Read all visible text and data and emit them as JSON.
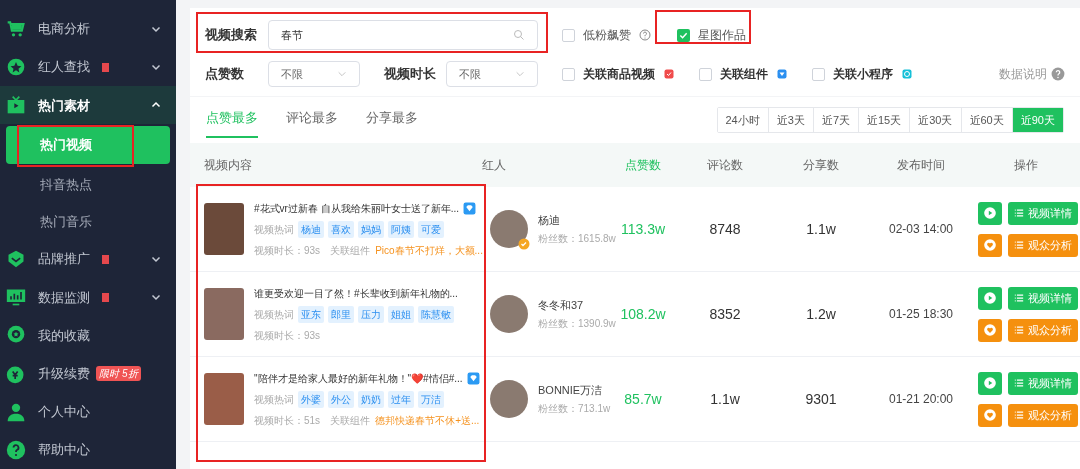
{
  "sidebar": {
    "items": [
      {
        "label": "电商分析",
        "kind": "menu",
        "expanded": false,
        "new_badge": false,
        "selected": false
      },
      {
        "label": "红人查找",
        "kind": "menu",
        "expanded": false,
        "new_badge": true,
        "selected": false
      },
      {
        "label": "热门素材",
        "kind": "menu",
        "expanded": true,
        "new_badge": false,
        "selected": false
      },
      {
        "label": "热门视频",
        "kind": "sub",
        "selected": true
      },
      {
        "label": "抖音热点",
        "kind": "sub",
        "selected": false
      },
      {
        "label": "热门音乐",
        "kind": "sub",
        "selected": false
      },
      {
        "label": "品牌推广",
        "kind": "menu",
        "expanded": false,
        "new_badge": true,
        "selected": false
      },
      {
        "label": "数据监测",
        "kind": "menu",
        "expanded": false,
        "new_badge": true,
        "selected": false
      },
      {
        "label": "我的收藏",
        "kind": "link",
        "selected": false
      },
      {
        "label": "升级续费",
        "kind": "link",
        "selected": false,
        "promo": [
          "限时",
          "5折"
        ]
      },
      {
        "label": "个人中心",
        "kind": "link",
        "selected": false
      },
      {
        "label": "帮助中心",
        "kind": "link",
        "selected": false
      }
    ]
  },
  "filters": {
    "search_label": "视频搜索",
    "search_value": "春节",
    "checks_top": [
      {
        "label": "低粉飙赞",
        "checked": false,
        "help": true
      },
      {
        "label": "星图作品",
        "checked": true
      }
    ],
    "selects": [
      {
        "label": "点赞数",
        "value": "不限"
      },
      {
        "label": "视频时长",
        "value": "不限"
      }
    ],
    "checks_bottom": [
      {
        "label": "关联商品视频",
        "checked": false,
        "color": "#f04b4b"
      },
      {
        "label": "关联组件",
        "checked": false,
        "color": "#2b8ff0"
      },
      {
        "label": "关联小程序",
        "checked": false,
        "color": "#16c0d8"
      }
    ],
    "data_note": "数据说明"
  },
  "tabs": [
    {
      "label": "点赞最多",
      "selected": true
    },
    {
      "label": "评论最多",
      "selected": false
    },
    {
      "label": "分享最多",
      "selected": false
    }
  ],
  "time_ranges": [
    {
      "label": "24小时",
      "selected": false
    },
    {
      "label": "近3天",
      "selected": false
    },
    {
      "label": "近7天",
      "selected": false
    },
    {
      "label": "近15天",
      "selected": false
    },
    {
      "label": "近30天",
      "selected": false
    },
    {
      "label": "近60天",
      "selected": false
    },
    {
      "label": "近90天",
      "selected": true
    }
  ],
  "table": {
    "columns": [
      {
        "label": "视频内容",
        "sorted": false
      },
      {
        "label": "红人",
        "sorted": false
      },
      {
        "label": "点赞数",
        "sorted": true
      },
      {
        "label": "评论数",
        "sorted": false
      },
      {
        "label": "分享数",
        "sorted": false
      },
      {
        "label": "发布时间",
        "sorted": false
      },
      {
        "label": "操作",
        "sorted": false
      }
    ],
    "rows": [
      {
        "title": "#花式vr过新春 自从我给朱丽叶女士送了新年...",
        "has_component": true,
        "keywords_label": "视频热词",
        "keywords": [
          "杨迪",
          "喜欢",
          "妈妈",
          "阿姨",
          "可爱"
        ],
        "duration": "视频时长：93s",
        "component_label": "关联组件",
        "component": "Pico春节不打烊，大额...",
        "name": "杨迪",
        "verified": true,
        "fans": "粉丝数：1615.8w",
        "likes": "113.3w",
        "comments": "8748",
        "shares": "1.1w",
        "time": "02-03 14:00",
        "actions": [
          "视频详情",
          "观众分析"
        ]
      },
      {
        "title": "谁更受欢迎一目了然！#长辈收到新年礼物的...",
        "has_component": false,
        "keywords_label": "视频热词",
        "keywords": [
          "亚东",
          "郎里",
          "压力",
          "姐姐",
          "陈慧敏"
        ],
        "duration": "视频时长：93s",
        "name": "冬冬和37",
        "verified": false,
        "fans": "粉丝数：1390.9w",
        "likes": "108.2w",
        "comments": "8352",
        "shares": "1.2w",
        "time": "01-25 18:30",
        "actions": [
          "视频详情",
          "观众分析"
        ]
      },
      {
        "title": "\"陪伴才是给家人最好的新年礼物！\"❤️#情侣#...",
        "has_component": true,
        "keywords_label": "视频热词",
        "keywords": [
          "外婆",
          "外公",
          "奶奶",
          "过年",
          "万洁"
        ],
        "duration": "视频时长：51s",
        "component_label": "关联组件",
        "component": "德邦快递春节不休+送...",
        "name": "BONNIE万洁",
        "verified": false,
        "fans": "粉丝数：713.1w",
        "likes": "85.7w",
        "comments": "1.1w",
        "shares": "9301",
        "time": "01-21 20:00",
        "actions": [
          "视频详情",
          "观众分析"
        ]
      }
    ]
  }
}
